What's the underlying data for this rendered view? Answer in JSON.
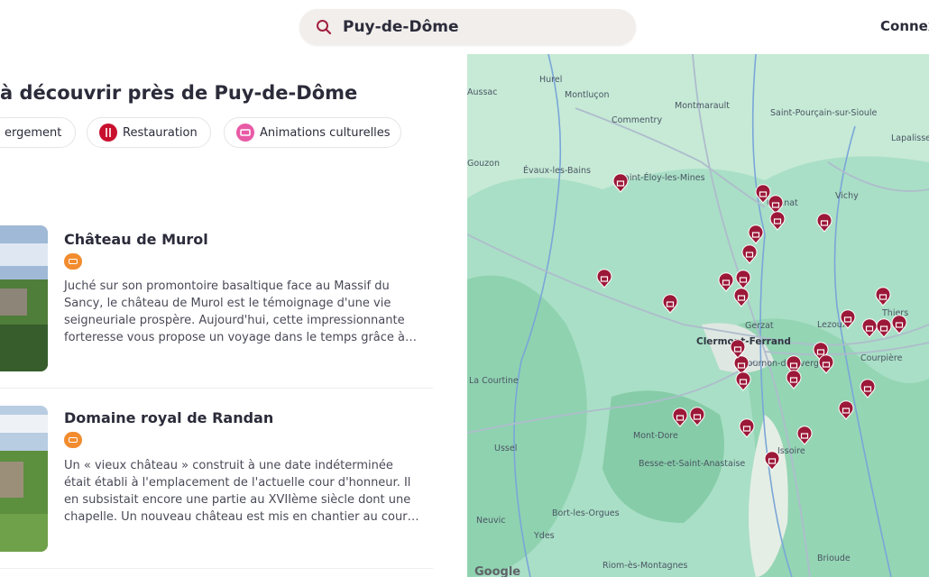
{
  "search": {
    "value": "Puy-de-Dôme"
  },
  "header": {
    "connect_label": "Connex"
  },
  "listing": {
    "heading": "à découvrir près de Puy-de-Dôme",
    "filters": [
      {
        "label": "ergement",
        "icon": "bed-icon"
      },
      {
        "label": "Restauration",
        "icon": "cutlery-icon"
      },
      {
        "label": "Animations culturelles",
        "icon": "ticket-icon"
      }
    ],
    "cards": [
      {
        "title": "Château de Murol",
        "badge_icon": "sofa-icon",
        "description": "Juché sur son promontoire basaltique face au Massif du Sancy, le château de Murol est le témoignage d'une vie seigneuriale prospère. Aujourd'hui, cette impressionnante forteresse vous propose un voyage dans le temps grâce à…"
      },
      {
        "title": "Domaine royal de Randan",
        "badge_icon": "sofa-icon",
        "description": "Un « vieux château » construit à une date indéterminée était établi à l'emplacement de l'actuelle cour d'honneur. Il en subsistait encore une partie au XVIIème siècle dont une chapelle. Un nouveau château est mis en chantier au cour…"
      }
    ]
  },
  "map": {
    "attribution": "Google",
    "towns": [
      "Hurel",
      "Montluçon",
      "Montmarault",
      "Commentry",
      "Saint-Pourçain-sur-Sioule",
      "Lapalisse",
      "Évaux-les-Bains",
      "Saint-Éloy-les-Mines",
      "Gannat",
      "Vichy",
      "Thiers",
      "Gerzat",
      "Clermont-Ferrand",
      "Lezoux",
      "Courpière",
      "Cournon-d'Auvergne",
      "La Courtine",
      "Mont-Dore",
      "Besse-et-Saint-Anastaise",
      "Issoire",
      "Ussel",
      "Bort-les-Orgues",
      "Neuvic",
      "Ydes",
      "Riom-ès-Montagnes",
      "Brioude",
      "Aussac",
      "Gouzon"
    ],
    "marker_count": 31
  }
}
